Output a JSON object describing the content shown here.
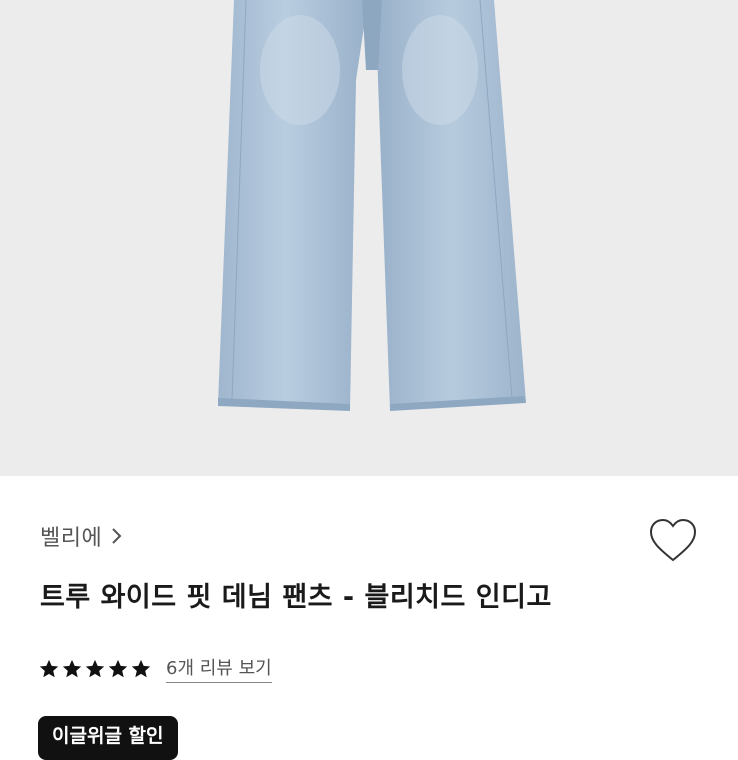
{
  "product": {
    "image_alt_icon": "jeans-image",
    "brand": "벨리에",
    "title": "트루 와이드 핏 데님 팬츠 - 블리치드 인디고",
    "rating": 5,
    "rating_max": 5,
    "review_link": "6개 리뷰 보기",
    "badge": "이글위글 할인"
  },
  "icons": {
    "brand_chevron": "chevron-right-icon",
    "like": "heart-outline-icon",
    "star": "star-icon"
  },
  "colors": {
    "hero_bg": "#ececec",
    "denim": "#a9c0d6",
    "badge_bg": "#111111",
    "text": "#1a1a1a"
  }
}
